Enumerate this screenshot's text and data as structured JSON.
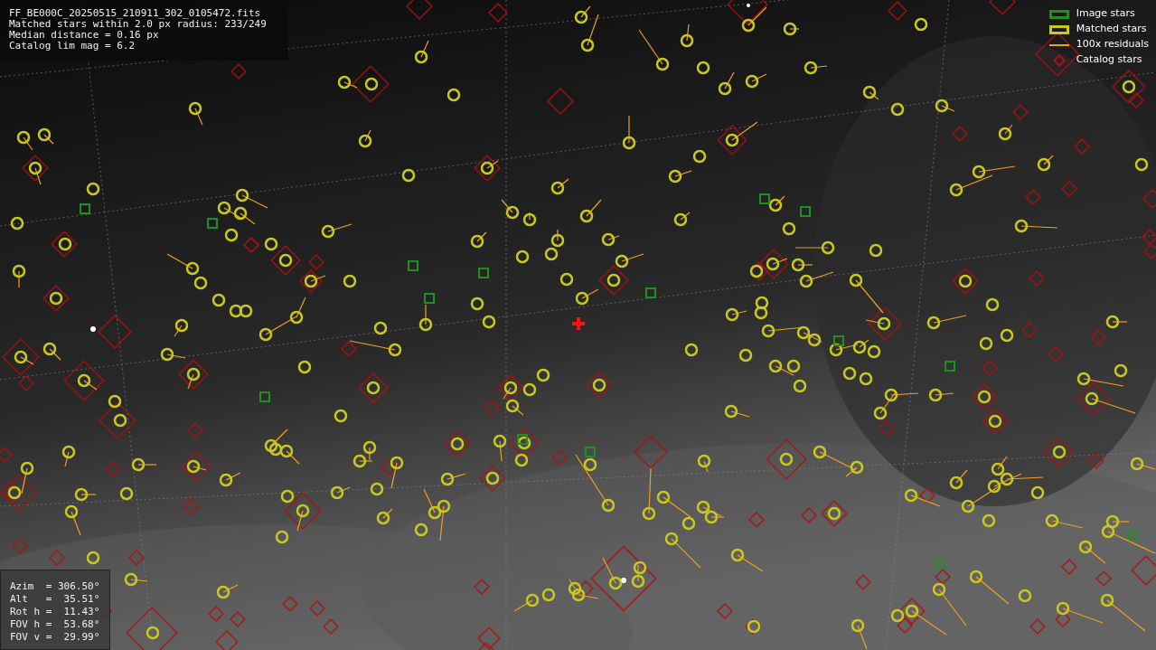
{
  "info_lines": [
    "FF_BE000C_20250515_210911_302_0105472.fits",
    "Matched stars within 2.0 px radius: 233/249",
    "Median distance = 0.16 px",
    "Catalog lim mag = 6.2"
  ],
  "legend": [
    {
      "label": "Image stars",
      "color": "#1f8f1f"
    },
    {
      "kind": "matched",
      "label": "Matched stars",
      "color": "#c8c81e"
    },
    {
      "kind": "residual",
      "label": "100x residuals",
      "color": "#f0a020"
    },
    {
      "kind": "catalog",
      "label": "Catalog stars",
      "color": "#b01010"
    }
  ],
  "pointing_lines": [
    "Azim  = 306.50°",
    "Alt   =  35.51°",
    "Rot h =  11.43°",
    "FOV h =  53.68°",
    "FOV v =  29.99°"
  ]
}
